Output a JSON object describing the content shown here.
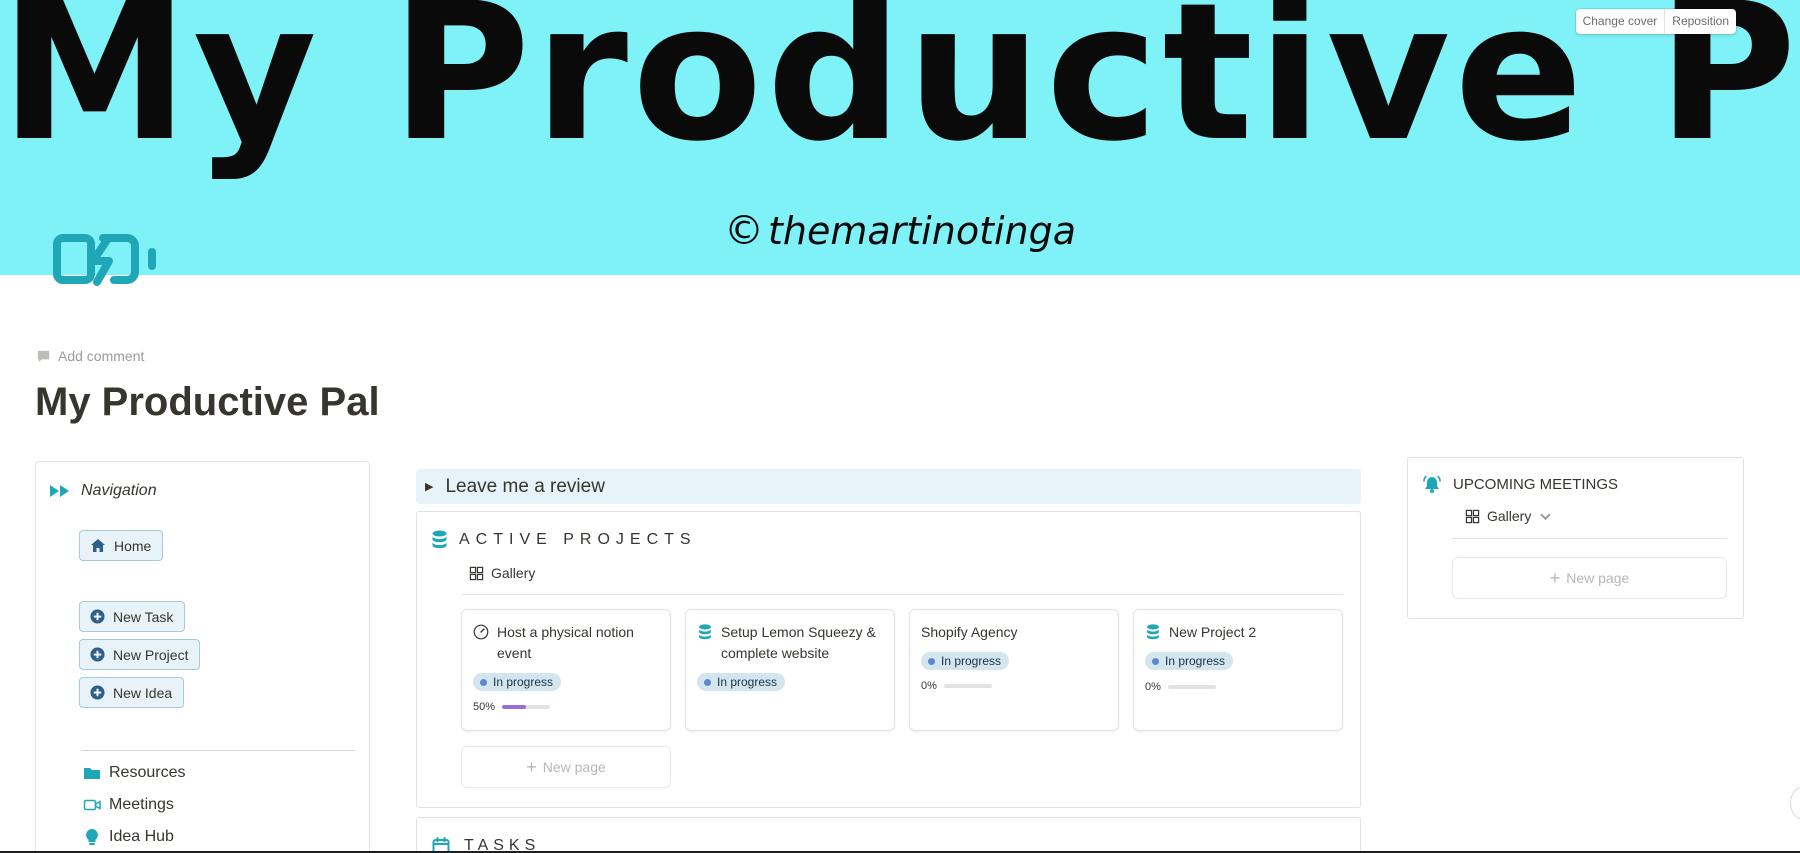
{
  "cover": {
    "title": "My Productive Pal",
    "credit_symbol": "©",
    "credit": "themartinotinga",
    "change_cover": "Change cover",
    "reposition": "Reposition",
    "color": "#7ff2f8"
  },
  "page": {
    "icon": "battery-charging-icon",
    "add_comment": "Add comment",
    "title": "My Productive Pal"
  },
  "navigation": {
    "title": "Navigation",
    "home": "Home",
    "buttons": [
      "New Task",
      "New Project",
      "New Idea"
    ],
    "links": [
      "Resources",
      "Meetings",
      "Idea Hub"
    ]
  },
  "review": {
    "label": "Leave me a review"
  },
  "projects": {
    "title": "ACTIVE PROJECTS",
    "view": "Gallery",
    "new_page": "New page",
    "cards": [
      {
        "title": "Host a physical notion event",
        "status": "In progress",
        "progress_label": "50%",
        "progress": 0.5,
        "icon": "speedometer-icon"
      },
      {
        "title": "Setup Lemon Squeezy & complete website",
        "status": "In progress",
        "icon": "database-icon"
      },
      {
        "title": "Shopify Agency",
        "status": "In progress",
        "progress_label": "0%",
        "progress": 0
      },
      {
        "title": "New Project 2",
        "status": "In progress",
        "progress_label": "0%",
        "progress": 0,
        "icon": "database-icon"
      }
    ]
  },
  "tasks": {
    "title": "TASKS"
  },
  "meetings": {
    "title": "UPCOMING MEETINGS",
    "view": "Gallery",
    "new_page": "New page"
  },
  "colors": {
    "accent_teal": "#1fa7b8",
    "badge_bg": "#d3e5ef",
    "badge_dot": "#5e87c9",
    "progress_fill": "#9a6dd7",
    "callout_bg": "#e7f3f8"
  }
}
